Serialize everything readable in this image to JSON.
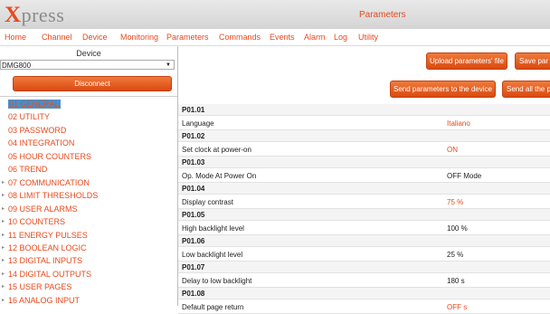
{
  "app": {
    "logo_first": "X",
    "logo_rest": "press",
    "page_title": "Parameters"
  },
  "menu": [
    "Home",
    "Channel",
    "Device",
    "Monitoring",
    "Parameters",
    "Commands",
    "Events",
    "Alarm",
    "Log",
    "Utility"
  ],
  "left": {
    "device_label": "Device",
    "device_value": "DMG800",
    "disconnect_label": "Disconnect",
    "tree": [
      {
        "label": "01 GENERAL",
        "expandable": false,
        "selected": true
      },
      {
        "label": "02 UTILITY",
        "expandable": false
      },
      {
        "label": "03 PASSWORD",
        "expandable": false
      },
      {
        "label": "04 INTEGRATION",
        "expandable": false
      },
      {
        "label": "05 HOUR COUNTERS",
        "expandable": false
      },
      {
        "label": "06 TREND",
        "expandable": false
      },
      {
        "label": "07 COMMUNICATION",
        "expandable": true
      },
      {
        "label": "08 LIMIT THRESHOLDS",
        "expandable": true
      },
      {
        "label": "09 USER ALARMS",
        "expandable": true
      },
      {
        "label": "10 COUNTERS",
        "expandable": true
      },
      {
        "label": "11 ENERGY PULSES",
        "expandable": true
      },
      {
        "label": "12 BOOLEAN LOGIC",
        "expandable": true
      },
      {
        "label": "13 DIGITAL INPUTS",
        "expandable": true
      },
      {
        "label": "14 DIGITAL OUTPUTS",
        "expandable": true
      },
      {
        "label": "15 USER PAGES",
        "expandable": true
      },
      {
        "label": "16 ANALOG INPUT",
        "expandable": true
      }
    ]
  },
  "toolbar": {
    "upload_label": "Upload parameters' file",
    "save_label": "Save par",
    "send_label": "Send parameters to the device",
    "send_all_label": "Send all the p"
  },
  "params": [
    {
      "code": "P01.01",
      "desc": "Language",
      "value": "Italiano",
      "editable": true
    },
    {
      "code": "P01.02",
      "desc": "Set clock at power-on",
      "value": "ON",
      "editable": true
    },
    {
      "code": "P01.03",
      "desc": "Op. Mode At Power On",
      "value": "OFF Mode",
      "editable": false
    },
    {
      "code": "P01.04",
      "desc": "Display contrast",
      "value": "75  %",
      "editable": true
    },
    {
      "code": "P01.05",
      "desc": "High backlight level",
      "value": "100  %",
      "editable": false
    },
    {
      "code": "P01.06",
      "desc": "Low backlight level",
      "value": "25  %",
      "editable": false
    },
    {
      "code": "P01.07",
      "desc": "Delay to low backlight",
      "value": "180  s",
      "editable": false
    },
    {
      "code": "P01.08",
      "desc": "Default page return",
      "value": "OFF  s",
      "editable": true
    }
  ],
  "colors": {
    "accent": "#e8491d",
    "selection": "#4a90c8"
  },
  "icons": {
    "tree_expand": "triangle-right-icon",
    "select_arrow": "triangle-down-icon"
  }
}
